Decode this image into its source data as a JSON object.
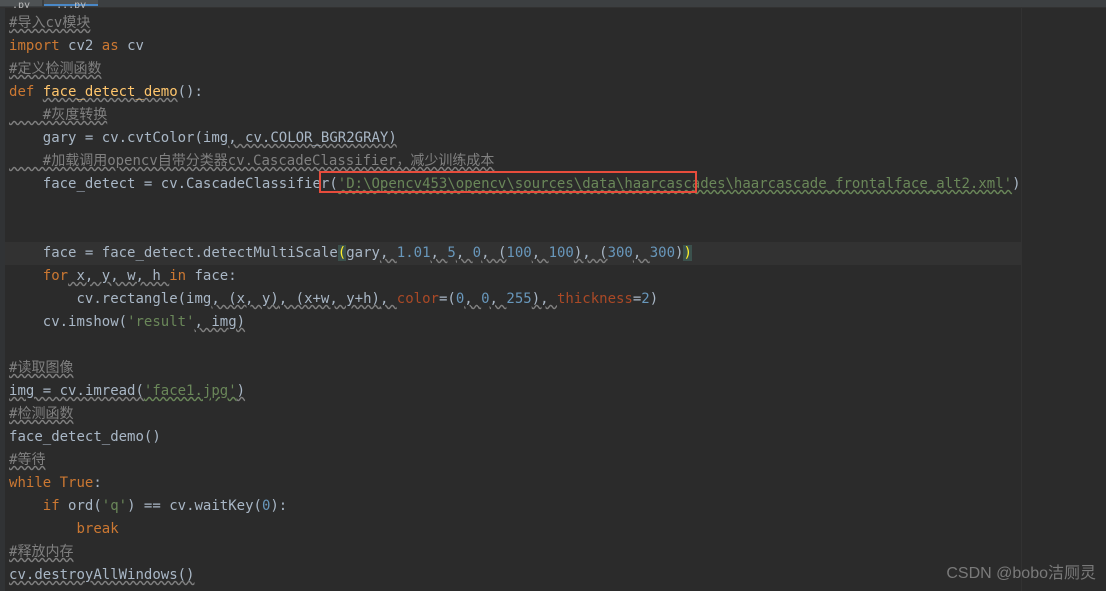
{
  "tabs": [
    {
      "label": ".py"
    },
    {
      "label": "...py"
    }
  ],
  "code": {
    "l1": "#导入cv模块",
    "l2_import": "import",
    "l2_cv2": " cv2 ",
    "l2_as": "as",
    "l2_cv": " cv",
    "l3": "#定义检测函数",
    "l4_def": "def ",
    "l4_name": "face_detect_demo",
    "l4_paren": "():",
    "l5": "    #灰度转换",
    "l6a": "    gary = cv.cvtColor(img",
    "l6b": ", cv.COLOR_BGR2GRAY)",
    "l7": "    #加载调用opencv自带分类器cv.CascadeClassifier，减少训练成本",
    "l8a": "    face_detect = cv.CascadeClassifier(",
    "l8s": "'D:\\Opencv453\\opencv\\sources\\data\\haarcascades\\haarcascade_frontalface_alt2.xml'",
    "l8b": ")",
    "l9a": "    face = face_detect.detectMultiScale",
    "l9p1": "(",
    "l9b": "gary",
    "l9c": ", ",
    "l9n1": "1.01",
    "l9n2": "5",
    "l9n3": "0",
    "l9d": ", (",
    "l9n4": "100",
    "l9n5": "100",
    "l9e": "), (",
    "l9n6": "300",
    "l9n7": "300",
    "l9f": ")",
    "l9p2": ")",
    "l10_for": "    for",
    "l10a": " x, y, w, h ",
    "l10_in": "in",
    "l10b": " face:",
    "l11a": "        cv.rectangle(img",
    "l11b": ", (x, y)",
    "l11c": ", (x+w, y+h)",
    "l11d": ", ",
    "l11_color": "color",
    "l11e": "=(",
    "l11n1": "0",
    "l11n2": "0",
    "l11n3": "255",
    "l11f": "), ",
    "l11_thick": "thickness",
    "l11g": "=",
    "l11n4": "2",
    "l11h": ")",
    "l12a": "    cv.imshow(",
    "l12s": "'result'",
    "l12b": ", img)",
    "l14": "#读取图像",
    "l15a": "img = cv.imread(",
    "l15s": "'face1.jpg'",
    "l15b": ")",
    "l16": "#检测函数",
    "l17": "face_detect_demo()",
    "l18": "#等待",
    "l19_while": "while ",
    "l19_true": "True",
    "l19a": ":",
    "l20_if": "    if",
    "l20a": " ord(",
    "l20s": "'q'",
    "l20b": ") == cv.waitKey(",
    "l20n": "0",
    "l20c": "):",
    "l21": "        ",
    "l21_break": "break",
    "l22": "#释放内存",
    "l23": "cv.destroyAllWindows()"
  },
  "watermark": "CSDN @bobo洁厕灵"
}
